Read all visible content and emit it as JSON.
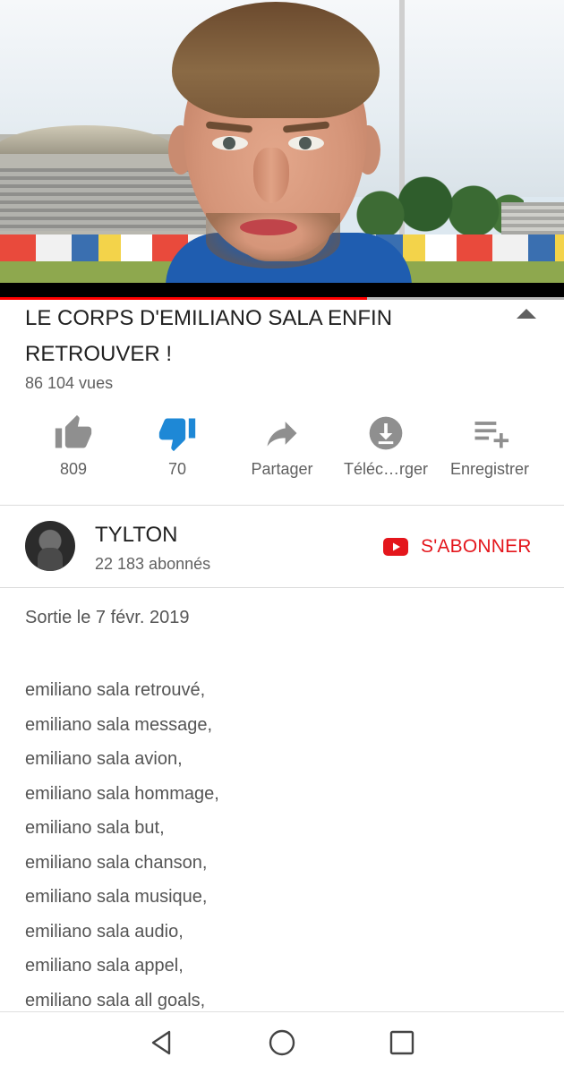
{
  "video": {
    "thumbnail": "portrait-of-young-man-in-stadium",
    "progress_fraction": 0.65
  },
  "title": "LE CORPS D'EMILIANO SALA ENFIN RETROUVER !",
  "views": "86 104 vues",
  "actions": {
    "like": {
      "icon": "thumbs-up-icon",
      "label": "809"
    },
    "dislike": {
      "icon": "thumbs-down-icon",
      "label": "70",
      "active_color": "#1e88d6"
    },
    "share": {
      "icon": "share-icon",
      "label": "Partager"
    },
    "download": {
      "icon": "download-icon",
      "label": "Téléc…rger"
    },
    "save": {
      "icon": "playlist-add-icon",
      "label": "Enregistrer"
    }
  },
  "channel": {
    "name": "TYLTON",
    "subscribers": "22 183 abonnés",
    "subscribe_label": "S'ABONNER",
    "subscribe_color": "#e4161c"
  },
  "description": {
    "release_date": "Sortie le 7 févr. 2019",
    "tags": [
      "emiliano sala retrouvé,",
      "emiliano sala message,",
      "emiliano sala avion,",
      "emiliano sala hommage,",
      "emiliano sala but,",
      "emiliano sala chanson,",
      "emiliano sala musique,",
      "emiliano sala audio,",
      "emiliano sala appel,",
      "emiliano sala all goals,"
    ]
  },
  "nav": [
    "back-icon",
    "home-icon",
    "recent-apps-icon"
  ]
}
